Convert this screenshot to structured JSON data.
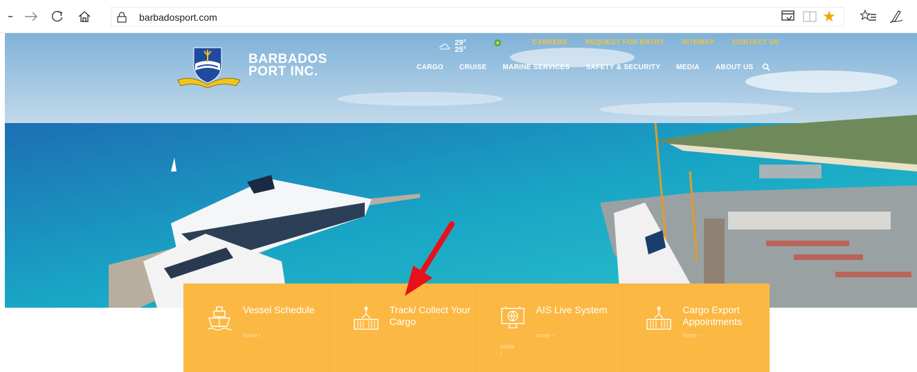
{
  "browser": {
    "url": "barbadosport.com"
  },
  "site": {
    "brand_line1": "BARBADOS",
    "brand_line2": "PORT INC.",
    "logo_ribbon": "BARBADOS PORT INC.",
    "weather": {
      "high": "29°",
      "low": "25°"
    },
    "utility_nav": [
      "CAREERS",
      "REQUEST FOR ENTRY",
      "SITEMAP",
      "CONTACT US"
    ],
    "main_nav": [
      "CARGO",
      "CRUISE",
      "MARINE SERVICES",
      "SAFETY & SECURITY",
      "MEDIA",
      "ABOUT US"
    ]
  },
  "quick_links": [
    {
      "title": "Vessel Schedule",
      "more": "more ›",
      "icon": "ship-icon"
    },
    {
      "title": "Track/ Collect Your Cargo",
      "more": "more ›",
      "icon": "crane-cargo-icon"
    },
    {
      "title": "AIS Live System",
      "more": "more ›",
      "icon": "monitor-globe-icon"
    },
    {
      "title": "Cargo Export Appointments",
      "more": "more ›",
      "icon": "crane-cargo-icon"
    }
  ],
  "colors": {
    "accent_yellow": "#fbb843",
    "nav_yellow": "#f5c23a",
    "annotation_arrow": "#e8111b",
    "sea": "#1a9fc0",
    "sky": "#9fc6e2"
  }
}
